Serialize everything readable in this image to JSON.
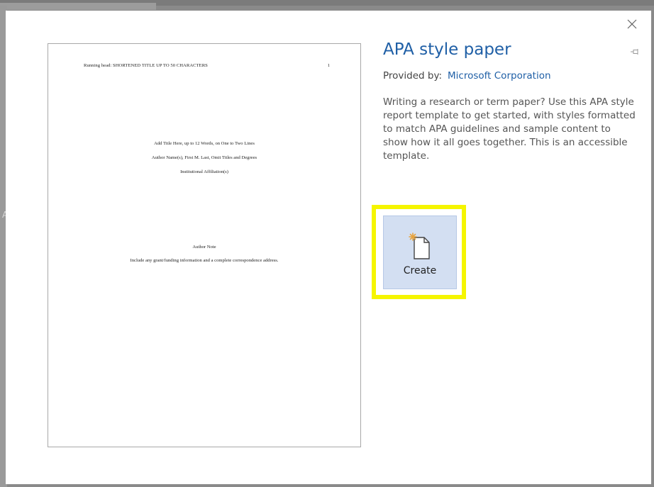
{
  "background": {
    "partial_text": "Al"
  },
  "dialog": {
    "close_glyph": "×"
  },
  "preview": {
    "running_head": "Running head: SHORTENED TITLE UP TO 50 CHARACTERS",
    "page_number": "1",
    "title_line": "Add Title Here, up to 12 Words, on One to Two Lines",
    "author_line": "Author Name(s), First M. Last, Omit Titles and Degrees",
    "affiliation_line": "Institutional Affiliation(s)",
    "author_note_heading": "Author Note",
    "author_note_text": "Include any grant/funding information and a complete correspondence address."
  },
  "info": {
    "title": "APA style paper",
    "provided_by_label": "Provided by:",
    "provider": "Microsoft Corporation",
    "description": "Writing a research or term paper? Use this APA style report template to get started, with styles formatted to match APA guidelines and sample content to show how it all goes together. This is an accessible template."
  },
  "create_button": {
    "label": "Create",
    "icon": "new-document-icon"
  },
  "colors": {
    "title_blue": "#1f5fa6",
    "highlight_yellow": "#f5f500",
    "button_bg": "#d3dff2"
  }
}
